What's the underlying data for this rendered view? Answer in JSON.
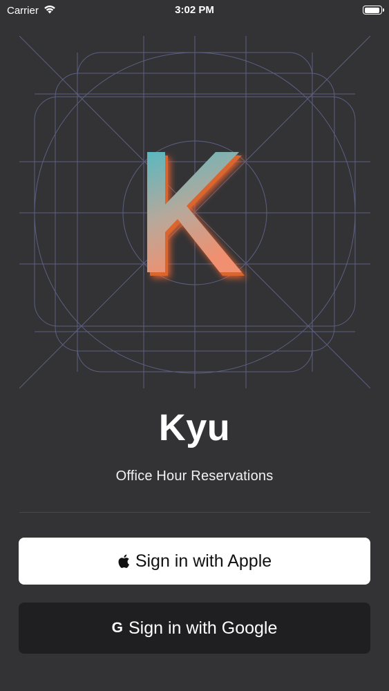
{
  "status_bar": {
    "carrier": "Carrier",
    "time": "3:02 PM",
    "battery_level": 1.0
  },
  "logo": {
    "letter": "K",
    "gradient_top": "#5ab8c0",
    "gradient_bottom": "#f09070",
    "glow": "#ff6a30"
  },
  "app": {
    "title": "Kyu",
    "subtitle": "Office Hour Reservations"
  },
  "buttons": {
    "apple": {
      "label": "Sign in with Apple",
      "icon": "apple-icon"
    },
    "google": {
      "label": "Sign in with Google",
      "icon": "google-g-icon",
      "icon_glyph": "G"
    }
  },
  "colors": {
    "background": "#333335",
    "grid_line": "#6a6f9e",
    "apple_button_bg": "#ffffff",
    "google_button_bg": "#1f1f21"
  }
}
